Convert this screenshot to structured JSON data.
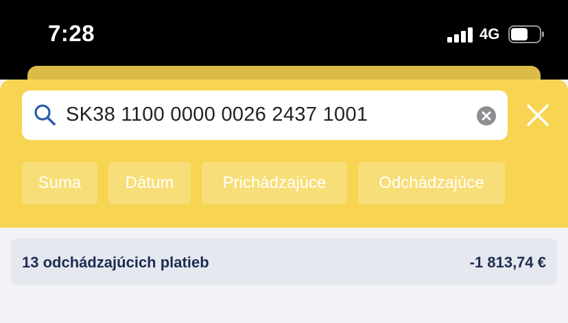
{
  "status_bar": {
    "time": "7:28",
    "network": "4G",
    "icons": [
      "signal-bars-icon",
      "battery-icon"
    ]
  },
  "search": {
    "value": "SK38 1100 0000 0026 2437 1001",
    "icons": [
      "search-icon",
      "clear-icon",
      "close-icon"
    ]
  },
  "filters": [
    {
      "label": "Suma"
    },
    {
      "label": "Dátum"
    },
    {
      "label": "Prichádzajúce"
    },
    {
      "label": "Odchádzajúce"
    }
  ],
  "summary": {
    "label": "13 odchádzajúcich platieb",
    "amount": "-1 813,74 €"
  },
  "colors": {
    "accent_yellow": "#f7d553",
    "summary_text": "#1e2c52",
    "search_icon": "#2b5ca8"
  }
}
